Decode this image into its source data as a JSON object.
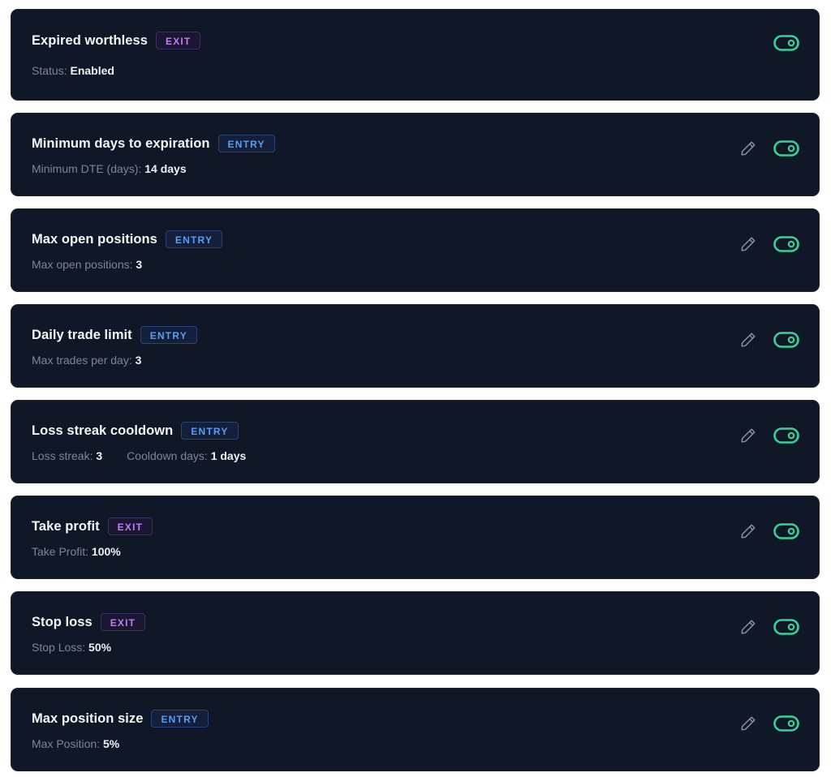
{
  "rules": [
    {
      "title": "Expired worthless",
      "badge": "EXIT",
      "badge_type": "exit",
      "editable": false,
      "enabled": true,
      "details": [
        {
          "label": "Status:",
          "value": "Enabled"
        }
      ]
    },
    {
      "title": "Minimum days to expiration",
      "badge": "ENTRY",
      "badge_type": "entry",
      "editable": true,
      "enabled": true,
      "details": [
        {
          "label": "Minimum DTE (days):",
          "value": "14 days"
        }
      ]
    },
    {
      "title": "Max open positions",
      "badge": "ENTRY",
      "badge_type": "entry",
      "editable": true,
      "enabled": true,
      "details": [
        {
          "label": "Max open positions:",
          "value": "3"
        }
      ]
    },
    {
      "title": "Daily trade limit",
      "badge": "ENTRY",
      "badge_type": "entry",
      "editable": true,
      "enabled": true,
      "details": [
        {
          "label": "Max trades per day:",
          "value": "3"
        }
      ]
    },
    {
      "title": "Loss streak cooldown",
      "badge": "ENTRY",
      "badge_type": "entry",
      "editable": true,
      "enabled": true,
      "details": [
        {
          "label": "Loss streak:",
          "value": "3"
        },
        {
          "label": "Cooldown days:",
          "value": "1 days"
        }
      ]
    },
    {
      "title": "Take profit",
      "badge": "EXIT",
      "badge_type": "exit",
      "editable": true,
      "enabled": true,
      "details": [
        {
          "label": "Take Profit:",
          "value": "100%"
        }
      ]
    },
    {
      "title": "Stop loss",
      "badge": "EXIT",
      "badge_type": "exit",
      "editable": true,
      "enabled": true,
      "details": [
        {
          "label": "Stop Loss:",
          "value": "50%"
        }
      ]
    },
    {
      "title": "Max position size",
      "badge": "ENTRY",
      "badge_type": "entry",
      "editable": true,
      "enabled": true,
      "details": [
        {
          "label": "Max Position:",
          "value": "5%"
        }
      ]
    }
  ],
  "icons": {
    "edit": "pencil-icon",
    "toggle": "toggle-on-icon"
  },
  "colors": {
    "card_background": "#101828",
    "toggle_on": "#34d399",
    "entry_badge": "#5b9df3",
    "exit_badge": "#c27ef0",
    "edit_icon": "#8b93a1"
  }
}
